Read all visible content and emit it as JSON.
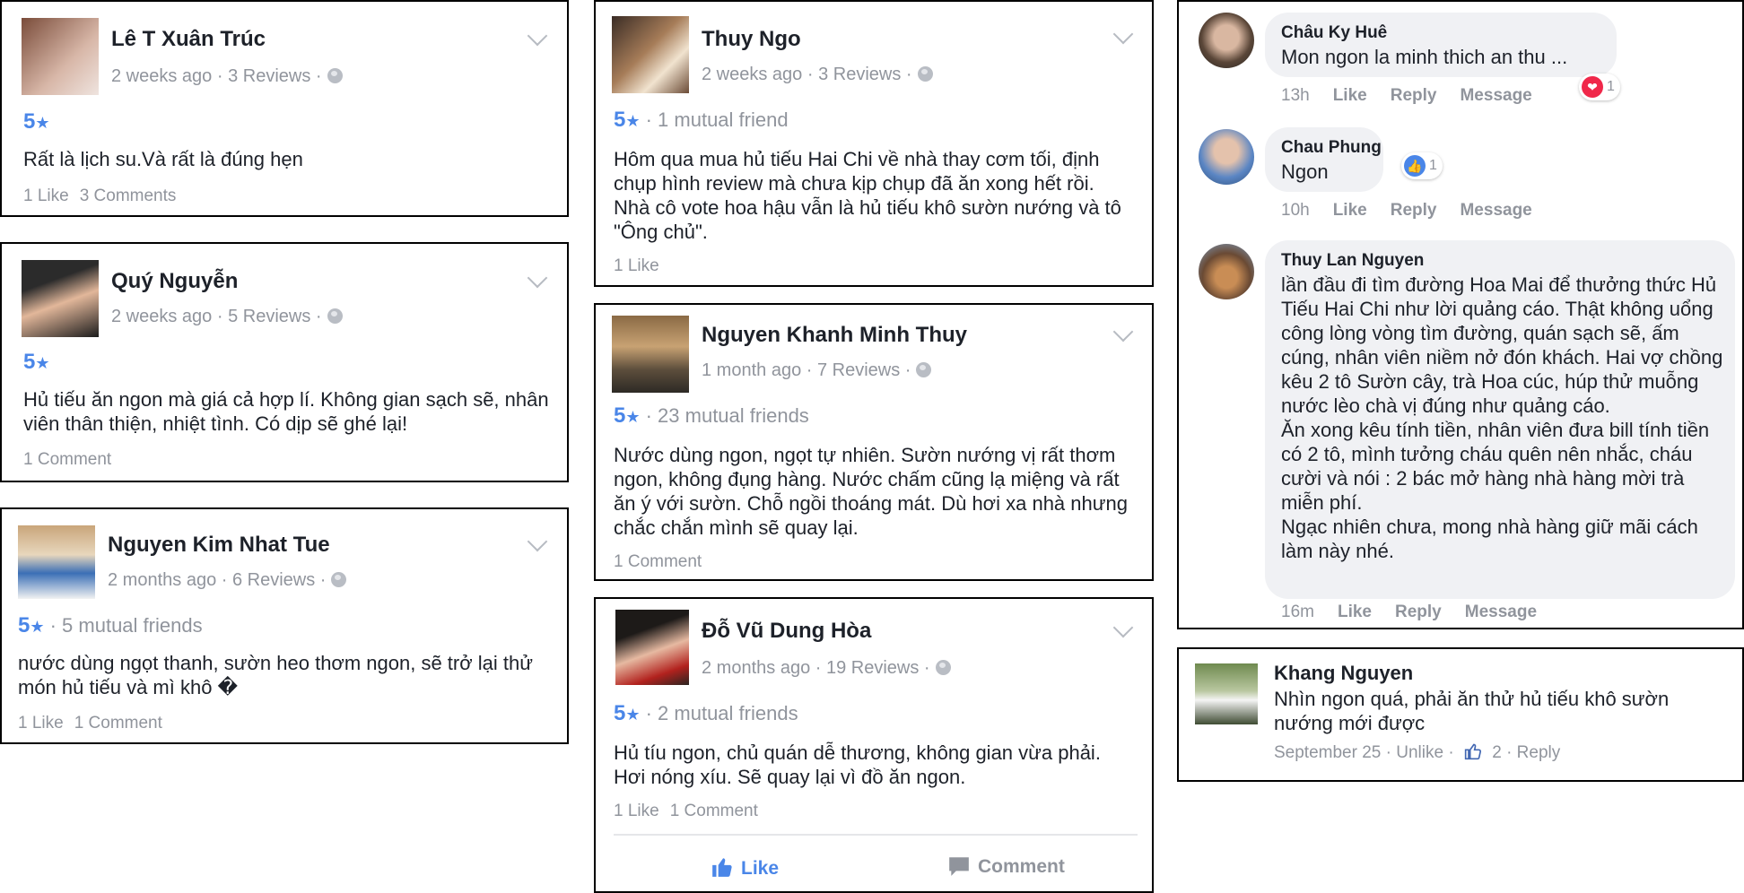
{
  "reviews": [
    {
      "name": "Lê T Xuân Trúc",
      "meta": "2 weeks ago · 3 Reviews ·",
      "rating_num": "5",
      "rating_star": "★",
      "rating_extra": "",
      "text": "Rất là lịch su.Và rất là đúng hẹn",
      "likes": "1 Like",
      "comments": "3 Comments"
    },
    {
      "name": "Quý Nguyễn",
      "meta": "2 weeks ago · 5 Reviews ·",
      "rating_num": "5",
      "rating_star": "★",
      "rating_extra": "",
      "text": "Hủ tiếu ăn ngon mà giá cả hợp lí. Không gian sạch sẽ, nhân viên thân thiện, nhiệt tình. Có dịp sẽ ghé lại!",
      "likes": "",
      "comments": "1 Comment"
    },
    {
      "name": "Nguyen Kim Nhat Tue",
      "meta": "2 months ago · 6 Reviews ·",
      "rating_num": "5",
      "rating_star": "★",
      "rating_extra": " · 5 mutual friends",
      "text": "nước dùng ngọt thanh, sườn heo thơm ngon, sẽ trở lại thử món hủ tiếu và mì khô �",
      "likes": "1 Like",
      "comments": "1 Comment"
    },
    {
      "name": "Thuy Ngo",
      "meta": "2 weeks ago · 3 Reviews ·",
      "rating_num": "5",
      "rating_star": "★",
      "rating_extra": " · 1 mutual friend",
      "text": "Hôm qua mua hủ tiếu Hai Chi về nhà thay cơm tối, định chụp hình review mà chưa kịp chụp đã ăn xong hết rồi. Nhà cô vote hoa hậu vẫn là hủ tiếu khô sườn nướng và tô \"Ông chủ\".",
      "likes": "1 Like",
      "comments": ""
    },
    {
      "name": "Nguyen Khanh Minh Thuy",
      "meta": "1 month ago · 7 Reviews ·",
      "rating_num": "5",
      "rating_star": "★",
      "rating_extra": " · 23 mutual friends",
      "text": "Nước dùng ngon, ngọt tự nhiên. Sườn nướng vị rất thơm ngon, không đụng hàng. Nước chấm cũng lạ miệng và rất ăn ý với sườn. Chỗ ngồi thoáng mát. Dù hơi xa nhà nhưng chắc chắn mình sẽ quay lại.",
      "likes": "",
      "comments": "1 Comment"
    },
    {
      "name": "Đỗ Vũ Dung Hòa",
      "meta": "2 months ago · 19 Reviews ·",
      "rating_num": "5",
      "rating_star": "★",
      "rating_extra": " · 2 mutual friends",
      "text": "Hủ tíu ngon, chủ quán dễ thương, không gian vừa phải. Hơi nóng xíu. Sẽ quay lại vì đồ ăn ngon.",
      "likes": "1 Like",
      "comments": "1 Comment",
      "like_button": "Like",
      "comment_button": "Comment"
    }
  ],
  "comments": [
    {
      "name": "Châu Ky Huê",
      "text": "Mon ngon la minh thich an thu ...",
      "time": "13h",
      "like": "Like",
      "reply": "Reply",
      "message": "Message",
      "reaction_count": "1"
    },
    {
      "name": "Chau Phung",
      "text": "Ngon",
      "time": "10h",
      "like": "Like",
      "reply": "Reply",
      "message": "Message",
      "reaction_count": "1"
    },
    {
      "name": "Thuy Lan Nguyen",
      "text": "lần đầu đi tìm đường Hoa Mai để thưởng thức Hủ Tiếu Hai Chi như lời quảng cáo. Thật không uổng công lòng vòng tìm đường, quán sạch sẽ, ấm cúng, nhân viên niềm nở đón khách. Hai vợ chồng kêu 2 tô Sườn cây, trà Hoa cúc, húp thử muỗng nước lèo chà vị đúng như quảng cáo.\nĂn xong kêu tính tiền, nhân viên đưa bill tính tiền có 2 tô, mình tưởng cháu quên nên nhắc, cháu cười và nói : 2 bác mở hàng nhà hàng mời trà miễn phí.\nNgạc nhiên chưa, mong nhà hàng giữ mãi cách làm này nhé.",
      "time": "16m",
      "like": "Like",
      "reply": "Reply",
      "message": "Message"
    }
  ],
  "khang": {
    "name": "Khang Nguyen",
    "text": "Nhìn ngon quá, phải ăn thử hủ tiếu khô sườn nướng mới được",
    "date": "September 25 · Unlike ·",
    "count": "2 · Reply"
  },
  "colors": {
    "accent": "#4a86e8",
    "like_blue": "#4267b2",
    "muted": "#90949c",
    "heart": "#f0284a"
  }
}
